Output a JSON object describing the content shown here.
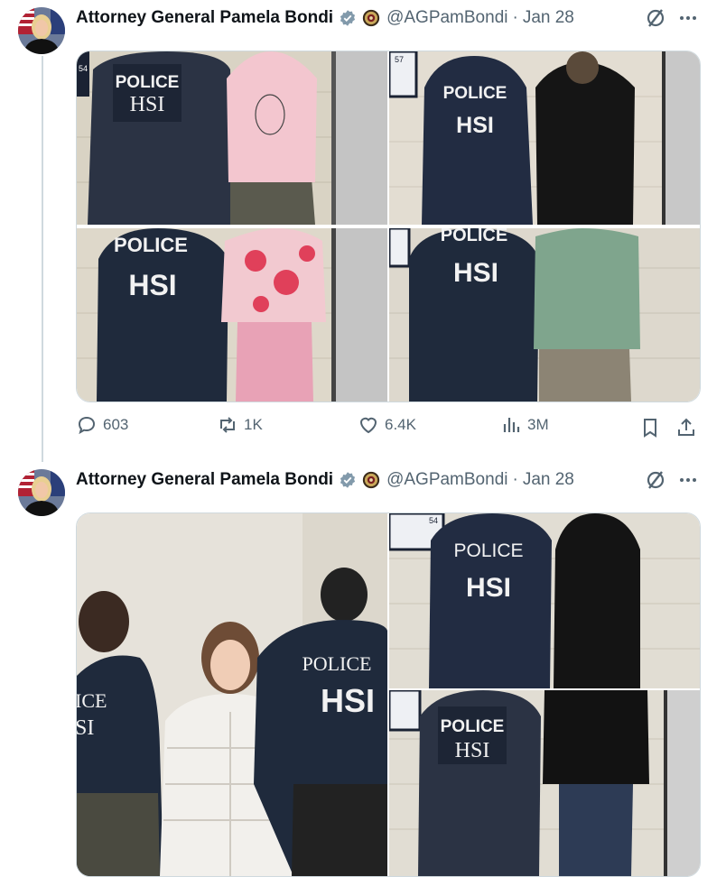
{
  "posts": [
    {
      "author_name": "Attorney General Pamela Bondi",
      "handle": "@AGPamBondi",
      "separator": "·",
      "date": "Jan 28",
      "photos": [
        {
          "vest_line1": "POLICE",
          "vest_line2": "HSI",
          "sign": "54"
        },
        {
          "vest_line1": "POLICE",
          "vest_line2": "HSI",
          "sign": "57"
        },
        {
          "vest_line1": "POLICE",
          "vest_line2": "HSI"
        },
        {
          "vest_line1": "POLICE",
          "vest_line2": "HSI"
        }
      ],
      "stats": {
        "replies": "603",
        "reposts": "1K",
        "likes": "6.4K",
        "views": "3M"
      }
    },
    {
      "author_name": "Attorney General Pamela Bondi",
      "handle": "@AGPamBondi",
      "separator": "·",
      "date": "Jan 28",
      "photos": [
        {
          "vest_a_line1": "ICE",
          "vest_a_line2": "SI",
          "vest_b_line1": "POLICE",
          "vest_b_line2": "HSI"
        },
        {
          "vest_line1": "POLICE",
          "vest_line2": "HSI",
          "sign": "54"
        },
        {
          "vest_line1": "POLICE",
          "vest_line2": "HSI"
        }
      ]
    }
  ],
  "colors": {
    "verified": "#829aab",
    "muted": "#536471",
    "border": "#cfd9de",
    "jacket": "#1f2a3c"
  },
  "icons": [
    "verified-badge-icon",
    "doj-seal-icon",
    "grok-icon",
    "more-icon",
    "reply-icon",
    "repost-icon",
    "like-icon",
    "views-icon",
    "bookmark-icon",
    "share-icon"
  ]
}
